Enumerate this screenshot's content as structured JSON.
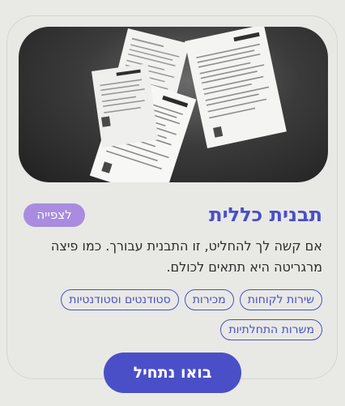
{
  "card": {
    "title": "תבנית כללית",
    "view_label": "לצפייה",
    "description": "אם קשה לך להחליט, זו התבנית עבורך. כמו פיצה מרגריטה היא תתאים לכולם.",
    "tags": [
      {
        "label": "שירות לקוחות"
      },
      {
        "label": "מכירות"
      },
      {
        "label": "סטודנטים וסטודנטיות"
      },
      {
        "label": "משרות התחלתיות"
      }
    ],
    "cta_label": "בואו נתחיל"
  },
  "colors": {
    "accent": "#4a4fc8",
    "badge": "#a98ce0",
    "background": "#e9eae6"
  }
}
